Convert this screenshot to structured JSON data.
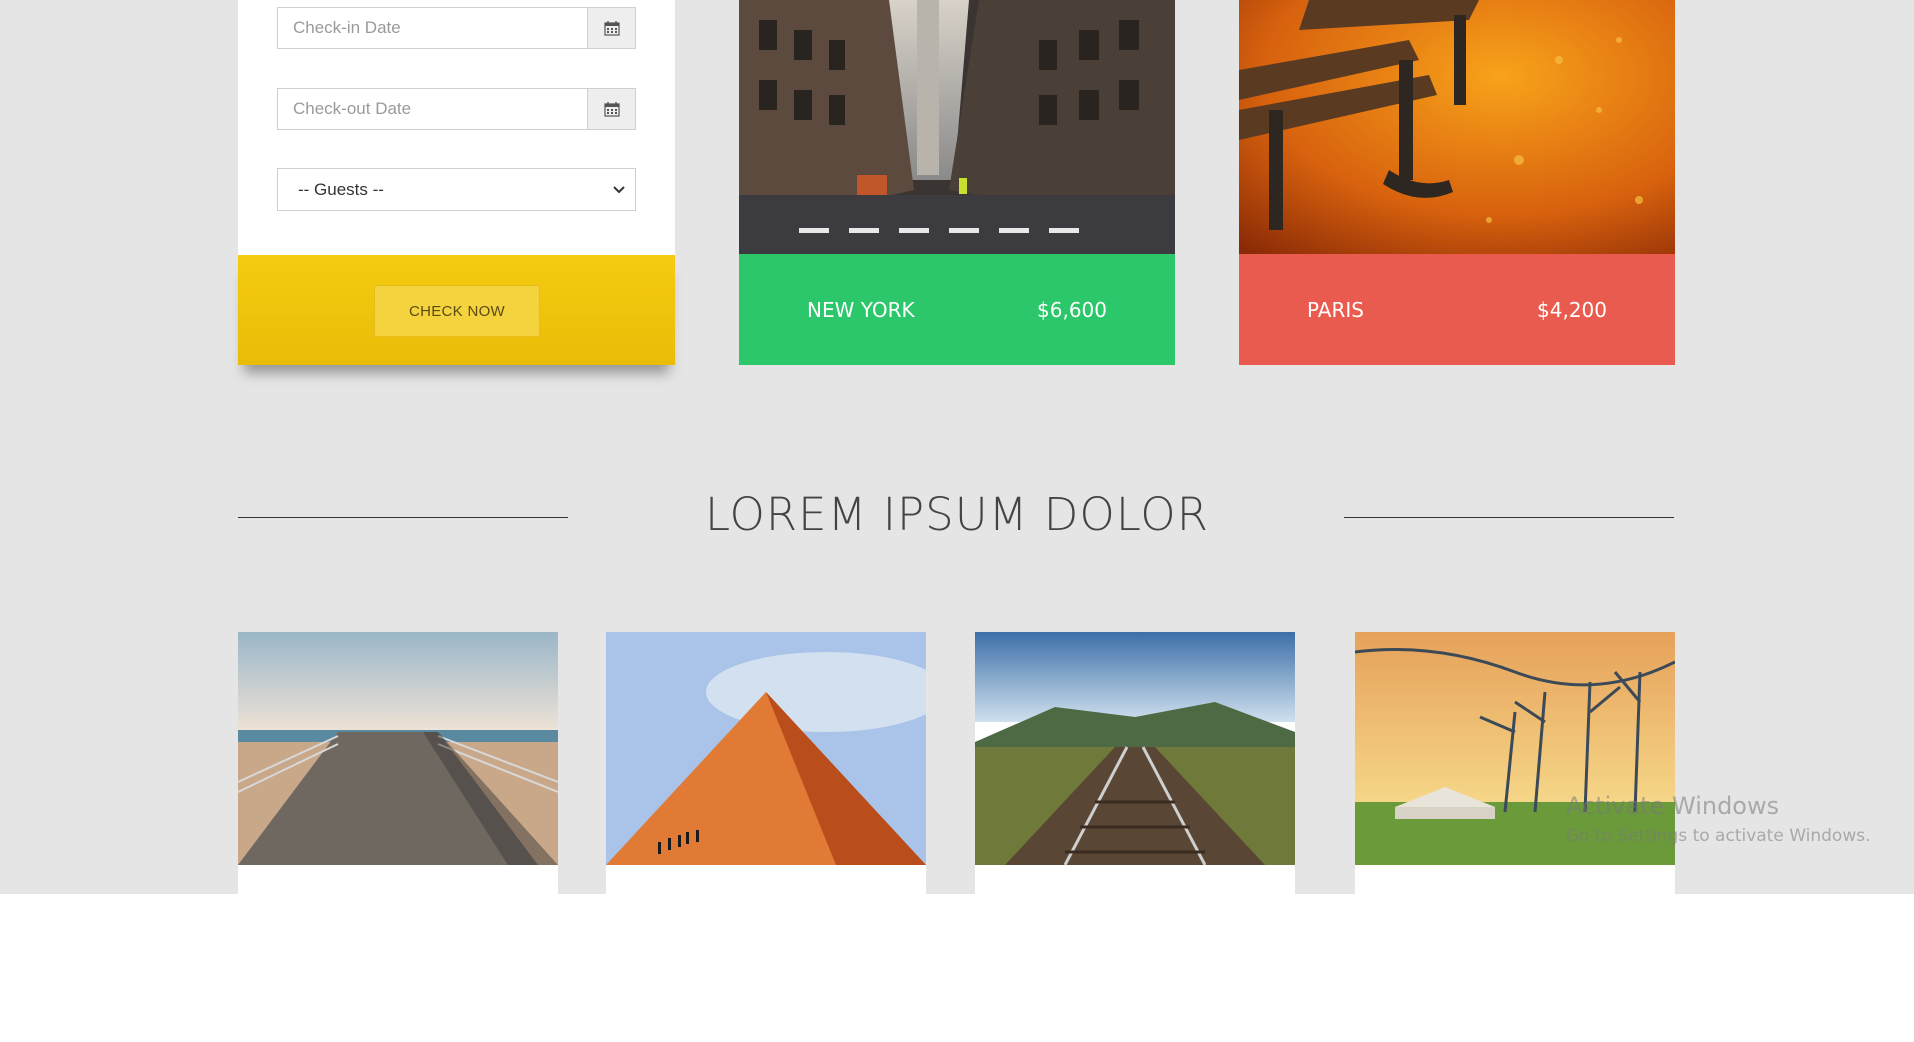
{
  "booking": {
    "checkin_placeholder": "Check-in Date",
    "checkout_placeholder": "Check-out Date",
    "guests_selected": "-- Guests --",
    "check_button": "CHECK NOW",
    "accent_color": "#f2c70f"
  },
  "destinations": [
    {
      "city": "NEW YORK",
      "price": "$6,600",
      "color": "#2bc76a"
    },
    {
      "city": "PARIS",
      "price": "$4,200",
      "color": "#ea5b4f"
    }
  ],
  "section": {
    "title": "LOREM IPSUM DOLOR"
  },
  "icons": {
    "calendar": "calendar-icon",
    "dropdown": "chevron-down-icon"
  },
  "watermark": {
    "title": "Activate Windows",
    "subtitle": "Go to Settings to activate Windows."
  }
}
